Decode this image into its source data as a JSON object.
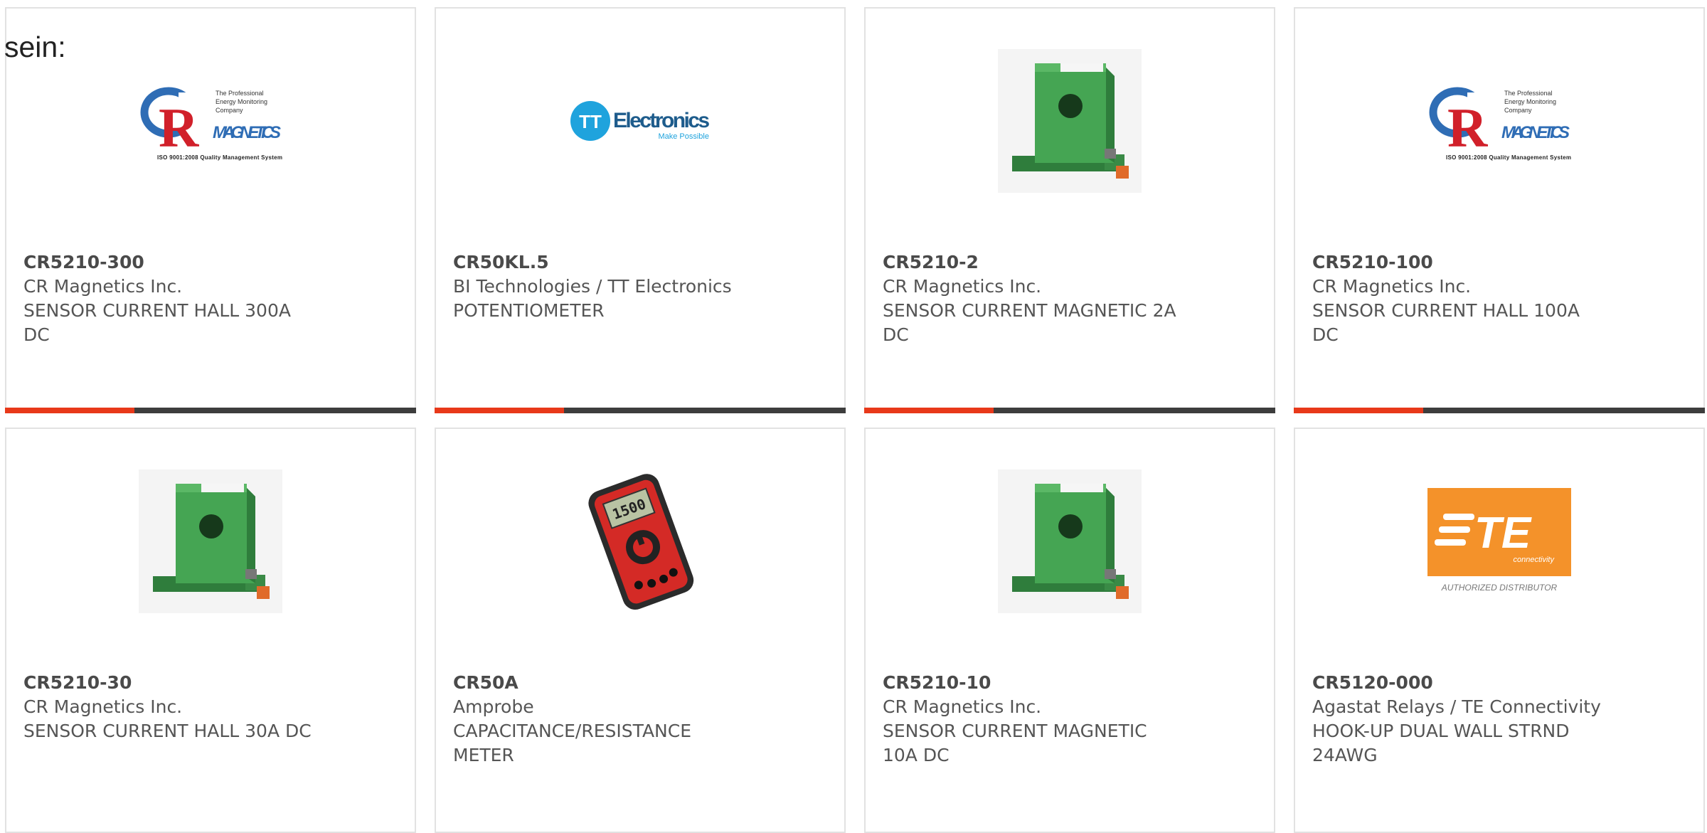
{
  "intro_text": "sein:",
  "brand_logos": {
    "cr": {
      "line1": "The Professional",
      "line2": "Energy Monitoring",
      "line3": "Company",
      "word": "MAGNETICS",
      "iso": "ISO 9001:2008 Quality Management System"
    },
    "tt": {
      "mark": "TT",
      "word": "Electronics",
      "tagline": "Make Possible"
    },
    "te": {
      "mark": "TE",
      "sub": "connectivity",
      "caption": "AUTHORIZED DISTRIBUTOR"
    },
    "meter": {
      "reading": "1500"
    }
  },
  "colors": {
    "accent": "#e8391a",
    "bar_dark": "#3d3d3d",
    "product_green": "#3f9a4f",
    "te_orange": "#f4922a"
  },
  "products": [
    {
      "part": "CR5210-300",
      "maker": "CR Magnetics Inc.",
      "desc": "SENSOR CURRENT HALL 300A DC",
      "image": "cr-magnetics-logo"
    },
    {
      "part": "CR50KL.5",
      "maker": "BI Technologies / TT Electronics",
      "desc": "POTENTIOMETER",
      "image": "tt-electronics-logo"
    },
    {
      "part": "CR5210-2",
      "maker": "CR Magnetics Inc.",
      "desc": "SENSOR CURRENT MAGNETIC 2A DC",
      "image": "current-sensor-photo"
    },
    {
      "part": "CR5210-100",
      "maker": "CR Magnetics Inc.",
      "desc": "SENSOR CURRENT HALL 100A DC",
      "image": "cr-magnetics-logo"
    },
    {
      "part": "CR5210-30",
      "maker": "CR Magnetics Inc.",
      "desc": "SENSOR CURRENT HALL 30A DC",
      "image": "current-sensor-photo"
    },
    {
      "part": "CR50A",
      "maker": "Amprobe",
      "desc": "CAPACITANCE/RESISTANCE METER",
      "image": "multimeter-photo"
    },
    {
      "part": "CR5210-10",
      "maker": "CR Magnetics Inc.",
      "desc": "SENSOR CURRENT MAGNETIC 10A DC",
      "image": "current-sensor-photo"
    },
    {
      "part": "CR5120-000",
      "maker": "Agastat Relays / TE Connectivity",
      "desc": "HOOK-UP DUAL WALL STRND 24AWG",
      "image": "te-connectivity-logo"
    }
  ]
}
